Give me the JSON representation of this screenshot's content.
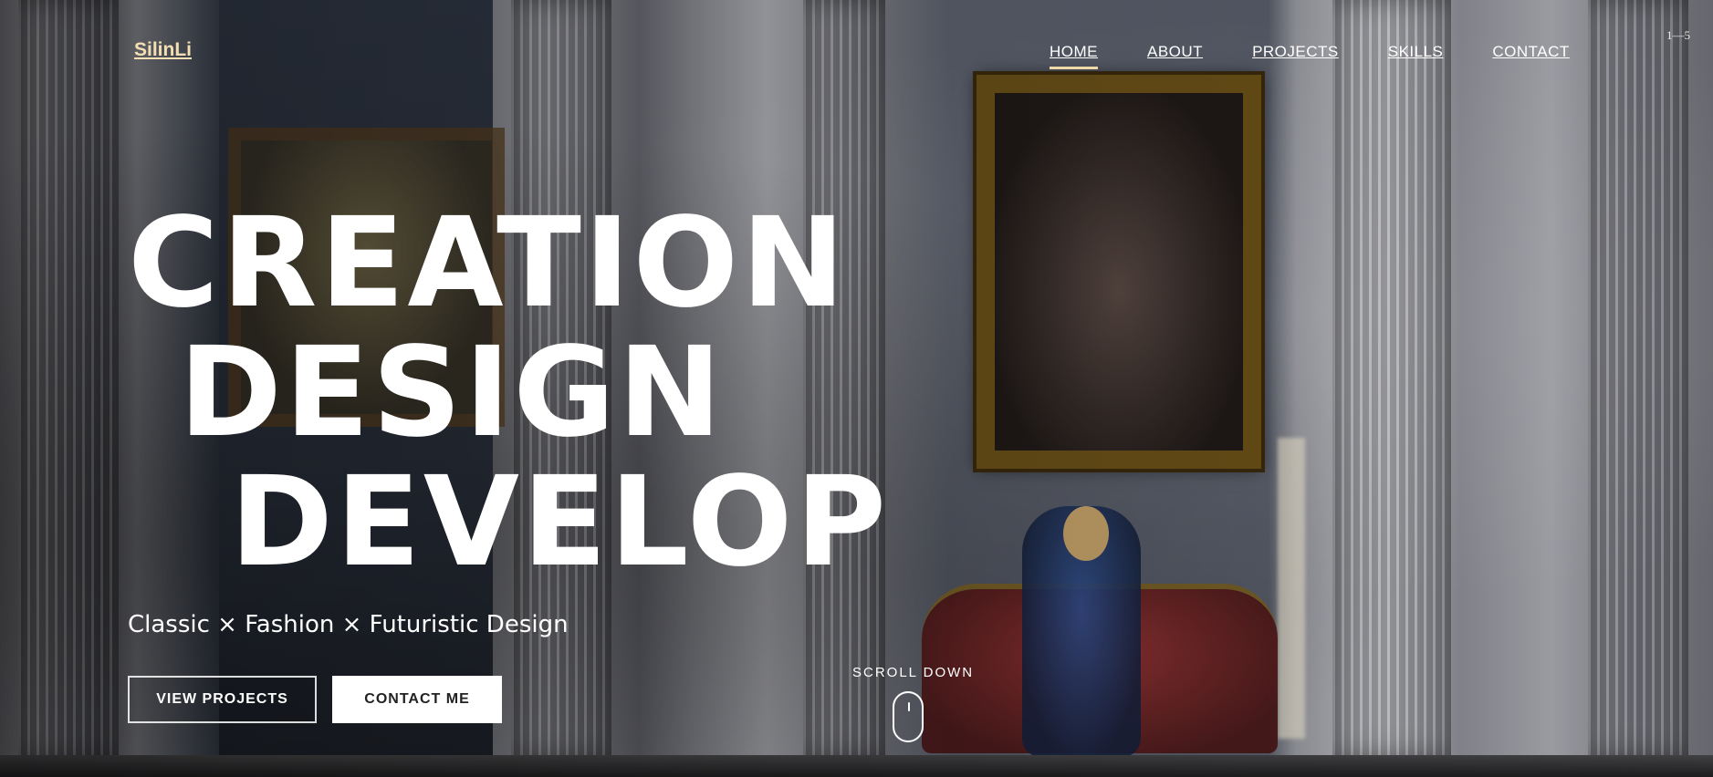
{
  "header": {
    "logo": "SilinLi",
    "nav": [
      {
        "label": "HOME",
        "active": true
      },
      {
        "label": "ABOUT",
        "active": false
      },
      {
        "label": "PROJECTS",
        "active": false
      },
      {
        "label": "SKILLS",
        "active": false
      },
      {
        "label": "CONTACT",
        "active": false
      }
    ],
    "page_counter": "1—5"
  },
  "hero": {
    "headline_lines": [
      "CREATION",
      "DESIGN",
      "DEVELOP"
    ],
    "subtitle": "Classic × Fashion × Futuristic Design",
    "buttons": {
      "view_projects": "VIEW PROJECTS",
      "contact_me": "CONTACT ME"
    },
    "scroll_label": "SCROLL DOWN"
  },
  "colors": {
    "logo": "#f4dfb4",
    "active_underline": "#f0d9a8",
    "text": "#ffffff"
  }
}
